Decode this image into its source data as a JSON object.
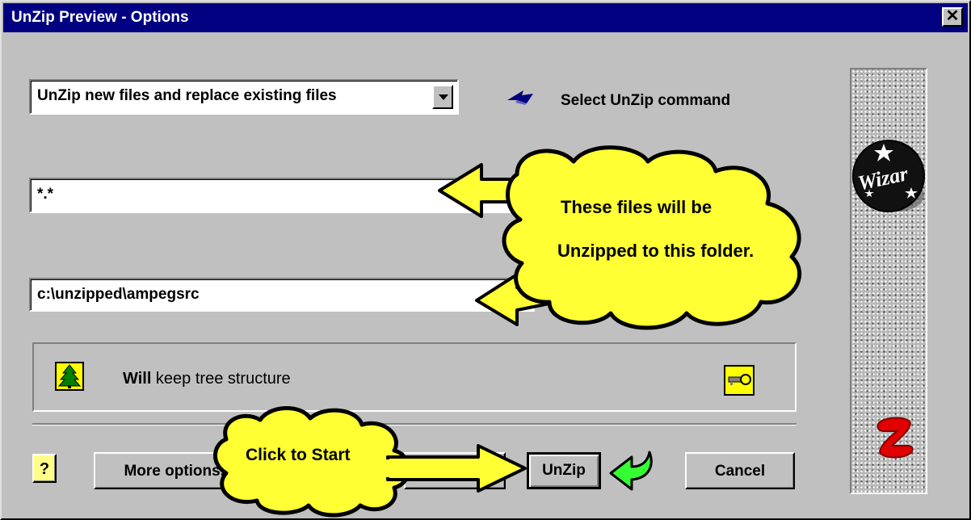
{
  "window": {
    "title": "UnZip Preview - Options",
    "close_glyph": "✕"
  },
  "command": {
    "selected": "UnZip new files and replace existing files",
    "label": "Select UnZip command"
  },
  "file_mask": {
    "value": "*.*"
  },
  "folder": {
    "value": "c:\\unzipped\\ampegsrc"
  },
  "tree": {
    "will": "Will",
    "rest": " keep tree structure"
  },
  "callouts": {
    "files_line1": "These files will be",
    "files_line2": "Unzipped to this folder.",
    "start": "Click to Start"
  },
  "buttons": {
    "help": "?",
    "more_options": "More options...",
    "unzip": "UnZip",
    "cancel": "Cancel"
  },
  "wizard": {
    "logo_text": "Wizar"
  },
  "colors": {
    "titlebar": "#000080",
    "window": "#c0c0c0",
    "callout": "#ffff33",
    "accent_green": "#33ff33"
  }
}
